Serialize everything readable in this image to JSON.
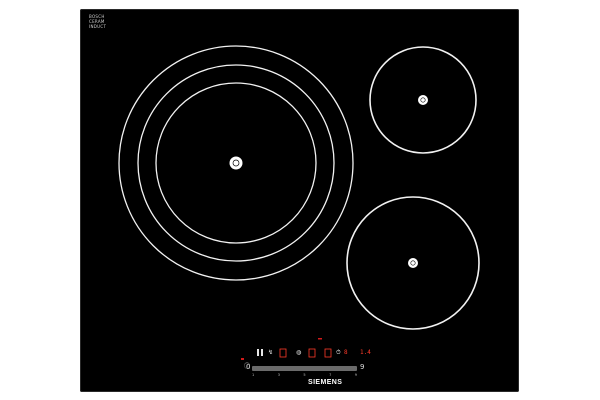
{
  "brand": {
    "name": "SIEMENS",
    "corner_mark": [
      "BOSCH",
      "CERAM",
      "INDUCT"
    ]
  },
  "cooktop": {
    "zones": [
      {
        "id": "large-flex",
        "rings": 3
      },
      {
        "id": "rear-right",
        "rings": 1
      },
      {
        "id": "front-right",
        "rings": 1
      }
    ]
  },
  "controls": {
    "slider_min": "0",
    "slider_max": "9",
    "slider_ticks": [
      "1",
      "3",
      "5",
      "7",
      "9"
    ],
    "display_left": "8",
    "display_right": "1.4",
    "symbols": [
      "◍",
      "↯",
      "⏱",
      "ⓘ"
    ]
  },
  "colors": {
    "glass": "#000000",
    "ring": "#f2f2f2",
    "display": "#ff3a2a"
  }
}
